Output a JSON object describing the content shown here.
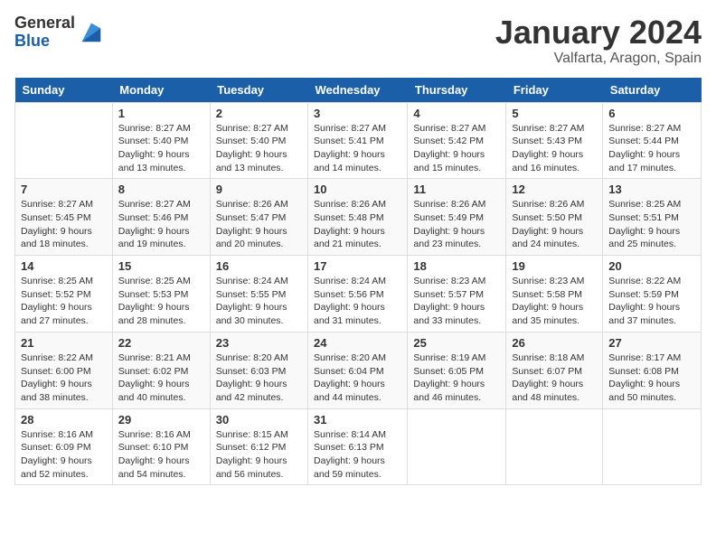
{
  "logo": {
    "general": "General",
    "blue": "Blue"
  },
  "title": "January 2024",
  "location": "Valfarta, Aragon, Spain",
  "days_of_week": [
    "Sunday",
    "Monday",
    "Tuesday",
    "Wednesday",
    "Thursday",
    "Friday",
    "Saturday"
  ],
  "weeks": [
    [
      {
        "num": "",
        "sunrise": "",
        "sunset": "",
        "daylight": "",
        "empty": true
      },
      {
        "num": "1",
        "sunrise": "Sunrise: 8:27 AM",
        "sunset": "Sunset: 5:40 PM",
        "daylight": "Daylight: 9 hours and 13 minutes."
      },
      {
        "num": "2",
        "sunrise": "Sunrise: 8:27 AM",
        "sunset": "Sunset: 5:40 PM",
        "daylight": "Daylight: 9 hours and 13 minutes."
      },
      {
        "num": "3",
        "sunrise": "Sunrise: 8:27 AM",
        "sunset": "Sunset: 5:41 PM",
        "daylight": "Daylight: 9 hours and 14 minutes."
      },
      {
        "num": "4",
        "sunrise": "Sunrise: 8:27 AM",
        "sunset": "Sunset: 5:42 PM",
        "daylight": "Daylight: 9 hours and 15 minutes."
      },
      {
        "num": "5",
        "sunrise": "Sunrise: 8:27 AM",
        "sunset": "Sunset: 5:43 PM",
        "daylight": "Daylight: 9 hours and 16 minutes."
      },
      {
        "num": "6",
        "sunrise": "Sunrise: 8:27 AM",
        "sunset": "Sunset: 5:44 PM",
        "daylight": "Daylight: 9 hours and 17 minutes."
      }
    ],
    [
      {
        "num": "7",
        "sunrise": "Sunrise: 8:27 AM",
        "sunset": "Sunset: 5:45 PM",
        "daylight": "Daylight: 9 hours and 18 minutes."
      },
      {
        "num": "8",
        "sunrise": "Sunrise: 8:27 AM",
        "sunset": "Sunset: 5:46 PM",
        "daylight": "Daylight: 9 hours and 19 minutes."
      },
      {
        "num": "9",
        "sunrise": "Sunrise: 8:26 AM",
        "sunset": "Sunset: 5:47 PM",
        "daylight": "Daylight: 9 hours and 20 minutes."
      },
      {
        "num": "10",
        "sunrise": "Sunrise: 8:26 AM",
        "sunset": "Sunset: 5:48 PM",
        "daylight": "Daylight: 9 hours and 21 minutes."
      },
      {
        "num": "11",
        "sunrise": "Sunrise: 8:26 AM",
        "sunset": "Sunset: 5:49 PM",
        "daylight": "Daylight: 9 hours and 23 minutes."
      },
      {
        "num": "12",
        "sunrise": "Sunrise: 8:26 AM",
        "sunset": "Sunset: 5:50 PM",
        "daylight": "Daylight: 9 hours and 24 minutes."
      },
      {
        "num": "13",
        "sunrise": "Sunrise: 8:25 AM",
        "sunset": "Sunset: 5:51 PM",
        "daylight": "Daylight: 9 hours and 25 minutes."
      }
    ],
    [
      {
        "num": "14",
        "sunrise": "Sunrise: 8:25 AM",
        "sunset": "Sunset: 5:52 PM",
        "daylight": "Daylight: 9 hours and 27 minutes."
      },
      {
        "num": "15",
        "sunrise": "Sunrise: 8:25 AM",
        "sunset": "Sunset: 5:53 PM",
        "daylight": "Daylight: 9 hours and 28 minutes."
      },
      {
        "num": "16",
        "sunrise": "Sunrise: 8:24 AM",
        "sunset": "Sunset: 5:55 PM",
        "daylight": "Daylight: 9 hours and 30 minutes."
      },
      {
        "num": "17",
        "sunrise": "Sunrise: 8:24 AM",
        "sunset": "Sunset: 5:56 PM",
        "daylight": "Daylight: 9 hours and 31 minutes."
      },
      {
        "num": "18",
        "sunrise": "Sunrise: 8:23 AM",
        "sunset": "Sunset: 5:57 PM",
        "daylight": "Daylight: 9 hours and 33 minutes."
      },
      {
        "num": "19",
        "sunrise": "Sunrise: 8:23 AM",
        "sunset": "Sunset: 5:58 PM",
        "daylight": "Daylight: 9 hours and 35 minutes."
      },
      {
        "num": "20",
        "sunrise": "Sunrise: 8:22 AM",
        "sunset": "Sunset: 5:59 PM",
        "daylight": "Daylight: 9 hours and 37 minutes."
      }
    ],
    [
      {
        "num": "21",
        "sunrise": "Sunrise: 8:22 AM",
        "sunset": "Sunset: 6:00 PM",
        "daylight": "Daylight: 9 hours and 38 minutes."
      },
      {
        "num": "22",
        "sunrise": "Sunrise: 8:21 AM",
        "sunset": "Sunset: 6:02 PM",
        "daylight": "Daylight: 9 hours and 40 minutes."
      },
      {
        "num": "23",
        "sunrise": "Sunrise: 8:20 AM",
        "sunset": "Sunset: 6:03 PM",
        "daylight": "Daylight: 9 hours and 42 minutes."
      },
      {
        "num": "24",
        "sunrise": "Sunrise: 8:20 AM",
        "sunset": "Sunset: 6:04 PM",
        "daylight": "Daylight: 9 hours and 44 minutes."
      },
      {
        "num": "25",
        "sunrise": "Sunrise: 8:19 AM",
        "sunset": "Sunset: 6:05 PM",
        "daylight": "Daylight: 9 hours and 46 minutes."
      },
      {
        "num": "26",
        "sunrise": "Sunrise: 8:18 AM",
        "sunset": "Sunset: 6:07 PM",
        "daylight": "Daylight: 9 hours and 48 minutes."
      },
      {
        "num": "27",
        "sunrise": "Sunrise: 8:17 AM",
        "sunset": "Sunset: 6:08 PM",
        "daylight": "Daylight: 9 hours and 50 minutes."
      }
    ],
    [
      {
        "num": "28",
        "sunrise": "Sunrise: 8:16 AM",
        "sunset": "Sunset: 6:09 PM",
        "daylight": "Daylight: 9 hours and 52 minutes."
      },
      {
        "num": "29",
        "sunrise": "Sunrise: 8:16 AM",
        "sunset": "Sunset: 6:10 PM",
        "daylight": "Daylight: 9 hours and 54 minutes."
      },
      {
        "num": "30",
        "sunrise": "Sunrise: 8:15 AM",
        "sunset": "Sunset: 6:12 PM",
        "daylight": "Daylight: 9 hours and 56 minutes."
      },
      {
        "num": "31",
        "sunrise": "Sunrise: 8:14 AM",
        "sunset": "Sunset: 6:13 PM",
        "daylight": "Daylight: 9 hours and 59 minutes."
      },
      {
        "num": "",
        "sunrise": "",
        "sunset": "",
        "daylight": "",
        "empty": true
      },
      {
        "num": "",
        "sunrise": "",
        "sunset": "",
        "daylight": "",
        "empty": true
      },
      {
        "num": "",
        "sunrise": "",
        "sunset": "",
        "daylight": "",
        "empty": true
      }
    ]
  ]
}
